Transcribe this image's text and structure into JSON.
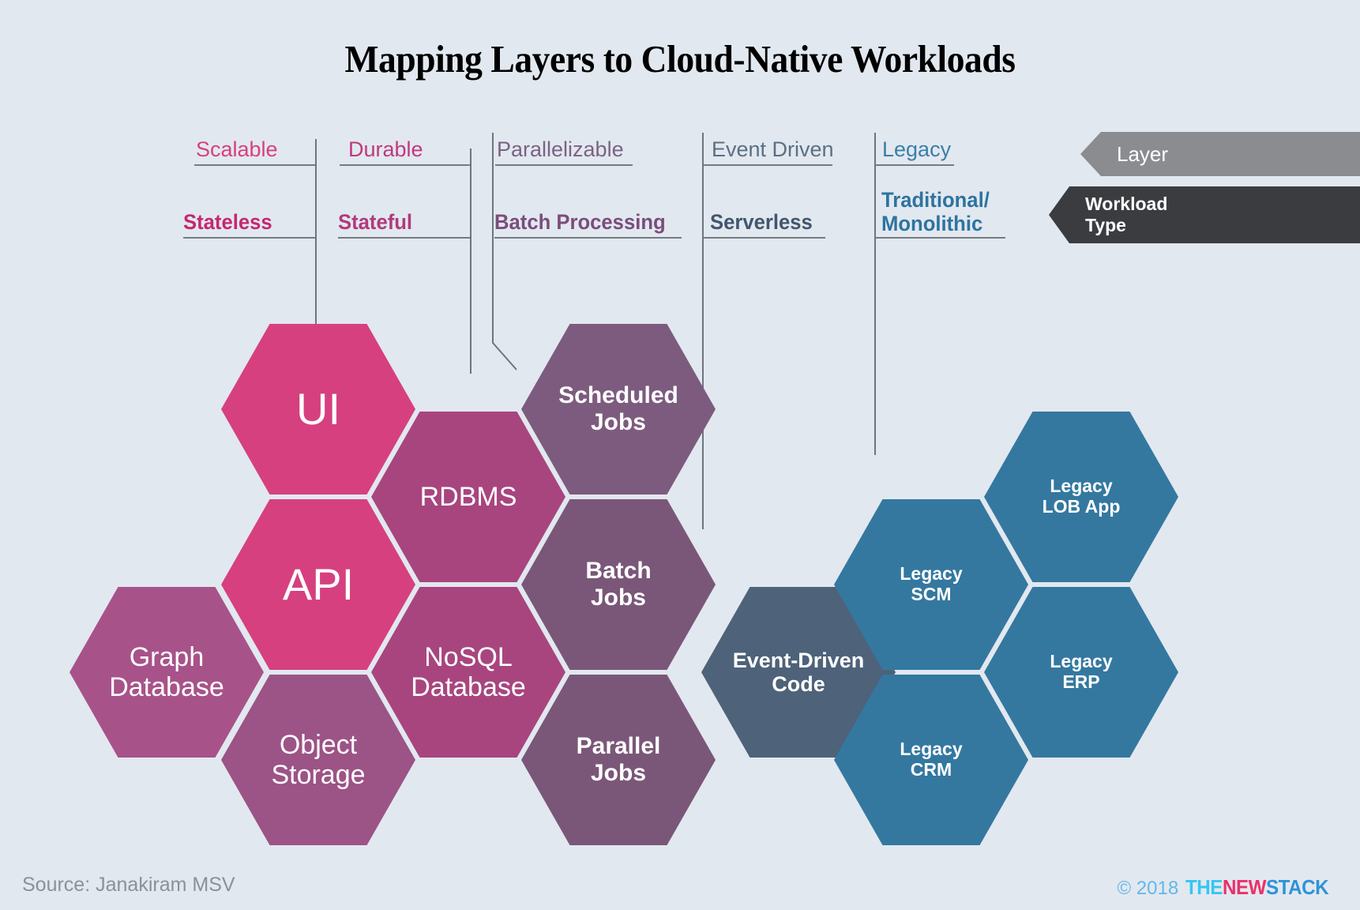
{
  "page": {
    "title": "Mapping Layers to Cloud-Native Workloads",
    "background": "#e2e8ef"
  },
  "legend": {
    "layer_label": "Layer",
    "layer_color": "#8a8c90",
    "workload_label": "Workload\nType",
    "workload_line1": "Workload",
    "workload_line2": "Type",
    "workload_color": "#3a3c40"
  },
  "columns": [
    {
      "layer": "Scalable",
      "workload_l1": "Stateless",
      "workload_l2": "",
      "color": "#d6407f"
    },
    {
      "layer": "Durable",
      "workload_l1": "Stateful",
      "workload_l2": "",
      "color": "#a8447f"
    },
    {
      "layer": "Parallelizable",
      "workload_l1": "Batch Processing",
      "workload_l2": "",
      "color": "#7d5b7e"
    },
    {
      "layer": "Event Driven",
      "workload_l1": "Serverless",
      "workload_l2": "",
      "color": "#4e6279"
    },
    {
      "layer": "Legacy",
      "workload_l1": "Traditional/",
      "workload_l2": "Monolithic",
      "color": "#3478a0"
    }
  ],
  "hexes": [
    {
      "l1": "UI",
      "l2": "",
      "color": "#d6407f",
      "weight": "thin",
      "size": 56
    },
    {
      "l1": "API",
      "l2": "",
      "color": "#d6407f",
      "weight": "thin",
      "size": 56
    },
    {
      "l1": "Graph",
      "l2": "Database",
      "color": "#a8528a",
      "weight": "thin",
      "size": 34
    },
    {
      "l1": "Object",
      "l2": "Storage",
      "color": "#9c5386",
      "weight": "thin",
      "size": 34
    },
    {
      "l1": "RDBMS",
      "l2": "",
      "color": "#a8457f",
      "weight": "thin",
      "size": 34
    },
    {
      "l1": "NoSQL",
      "l2": "Database",
      "color": "#a8457f",
      "weight": "thin",
      "size": 34
    },
    {
      "l1": "Scheduled",
      "l2": "Jobs",
      "color": "#7d5b7e",
      "weight": "bold",
      "size": 30
    },
    {
      "l1": "Batch",
      "l2": "Jobs",
      "color": "#7a5778",
      "weight": "bold",
      "size": 30
    },
    {
      "l1": "Parallel",
      "l2": "Jobs",
      "color": "#7a5778",
      "weight": "bold",
      "size": 30
    },
    {
      "l1": "Event-Driven",
      "l2": "Code",
      "color": "#4e6279",
      "weight": "bold",
      "size": 27
    },
    {
      "l1": "Legacy",
      "l2": "SCM",
      "color": "#3478a0",
      "weight": "bold",
      "size": 23
    },
    {
      "l1": "Legacy",
      "l2": "CRM",
      "color": "#3478a0",
      "weight": "bold",
      "size": 23
    },
    {
      "l1": "Legacy",
      "l2": "LOB App",
      "color": "#3478a0",
      "weight": "bold",
      "size": 23
    },
    {
      "l1": "Legacy",
      "l2": "ERP",
      "color": "#3478a0",
      "weight": "bold",
      "size": 23
    }
  ],
  "footer": {
    "source": "Source: Janakiram MSV",
    "copyright": "© 2018",
    "logo_the": "THE",
    "logo_new": "NEW",
    "logo_stack": "STACK"
  }
}
